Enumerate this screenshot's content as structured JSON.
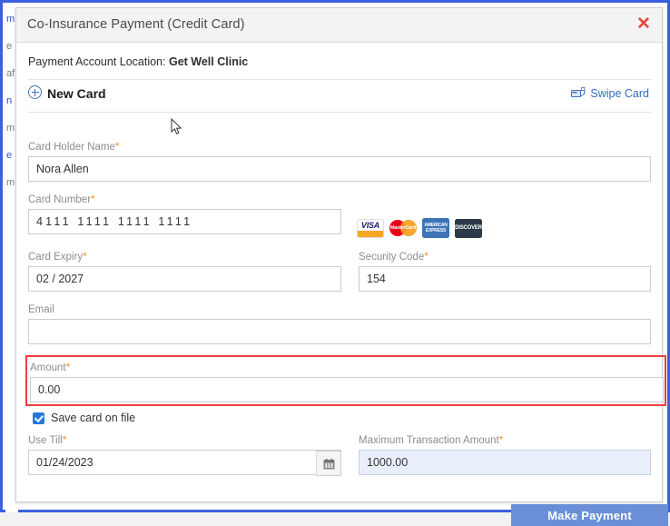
{
  "dialog": {
    "title": "Co-Insurance Payment (Credit Card)",
    "close_icon": "close-icon",
    "close_label": "✕"
  },
  "account": {
    "label": "Payment Account Location:",
    "value": "Get Well Clinic"
  },
  "card_source": {
    "new_card_label": "New Card",
    "new_card_icon": "circle-plus-icon",
    "swipe_label": "Swipe Card",
    "swipe_icon": "card-reader-icon"
  },
  "fields": {
    "card_holder_name": {
      "label": "Card Holder Name",
      "required_marker": "*",
      "value": "Nora Allen",
      "placeholder": ""
    },
    "card_number": {
      "label": "Card Number",
      "required_marker": "*",
      "value": "4111 1111 1111 1111",
      "placeholder": ""
    },
    "card_expiry": {
      "label": "Card Expiry",
      "required_marker": "*",
      "value": "02 / 2027",
      "placeholder": ""
    },
    "security_code": {
      "label": "Security Code",
      "required_marker": "*",
      "value": "154",
      "placeholder": ""
    },
    "email": {
      "label": "Email",
      "required_marker": "",
      "value": "",
      "placeholder": ""
    },
    "amount": {
      "label": "Amount",
      "required_marker": "*",
      "value": "0.00",
      "placeholder": "",
      "error_highlight_color": "#ec403c"
    },
    "use_till": {
      "label": "Use Till",
      "required_marker": "*",
      "value": "01/24/2023",
      "placeholder": "",
      "calendar_icon": "calendar-icon"
    },
    "maximum_transaction_amount": {
      "label": "Maximum Transaction Amount",
      "required_marker": "*",
      "value": "1000.00",
      "placeholder": "",
      "readonly": true
    }
  },
  "save_card": {
    "label": "Save card on file",
    "checked": true
  },
  "actions": {
    "make_payment_label": "Make Payment"
  },
  "card_brands": [
    {
      "name": "visa-logo",
      "text": "VISA"
    },
    {
      "name": "mastercard-logo",
      "text": "MasterCard"
    },
    {
      "name": "amex-logo",
      "line1": "AMERICAN",
      "line2": "EXPRESS"
    },
    {
      "name": "discover-logo",
      "text": "DISCOVER"
    }
  ],
  "background_page": {
    "fragments": [
      "m",
      "e",
      "a",
      "af",
      "n",
      "m",
      "e",
      "m"
    ]
  },
  "colors": {
    "frame_blue": "#3b5fdd",
    "accent_blue": "#2f6cc0",
    "error_red": "#ec403c",
    "button_blue": "#6a8fd8",
    "required_orange": "#f0922b",
    "readonly_bg": "#e9eefb"
  }
}
